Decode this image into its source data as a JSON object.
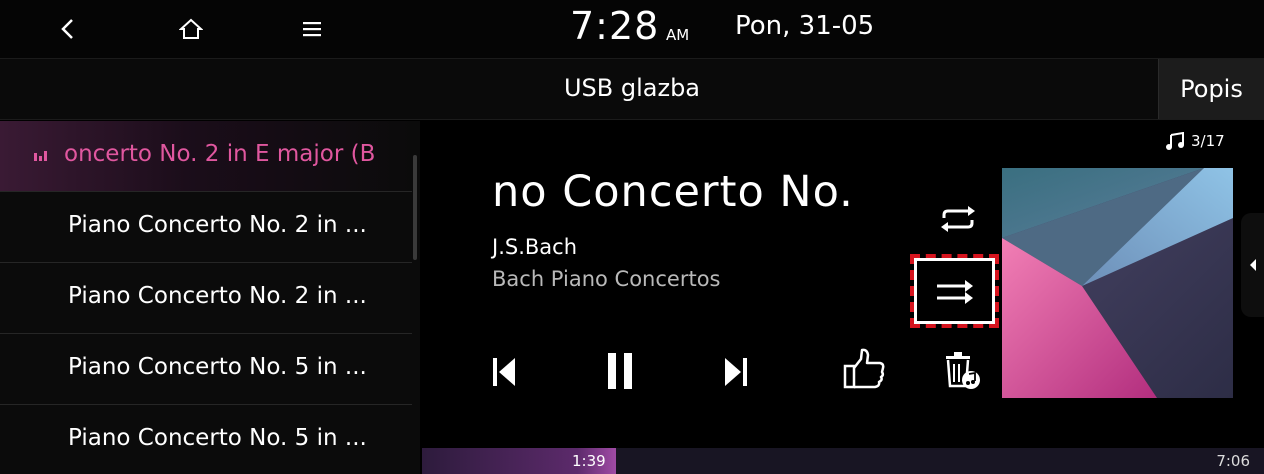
{
  "status_bar": {
    "time": "7:28",
    "ampm": "AM",
    "date": "Pon, 31-05",
    "icons": [
      "back-icon",
      "home-icon",
      "menu-icon"
    ]
  },
  "header": {
    "title": "USB glazba",
    "list_button": "Popis"
  },
  "tracklist": {
    "items": [
      {
        "label": "oncerto No. 2 in E major (B",
        "active": true
      },
      {
        "label": "Piano Concerto No. 2 in ...",
        "active": false
      },
      {
        "label": "Piano Concerto No. 2 in ...",
        "active": false
      },
      {
        "label": "Piano Concerto No. 5 in ...",
        "active": false
      },
      {
        "label": "Piano Concerto No. 5 in ...",
        "active": false
      }
    ]
  },
  "player": {
    "track_counter": "3/17",
    "title": "no Concerto No.",
    "artist": "J.S.Bach",
    "album": "Bach Piano Concertos",
    "elapsed": "1:39",
    "total": "7:06",
    "progress_fraction": 0.23,
    "icons": [
      "previous-icon",
      "pause-icon",
      "next-icon",
      "thumbs-up-icon",
      "delete-music-icon",
      "repeat-icon",
      "shuffle-icon",
      "music-note-icon",
      "collapse-arrow-icon"
    ]
  },
  "colors": {
    "accent": "#e0579f",
    "highlight": "#d6141e",
    "background": "#000000"
  }
}
